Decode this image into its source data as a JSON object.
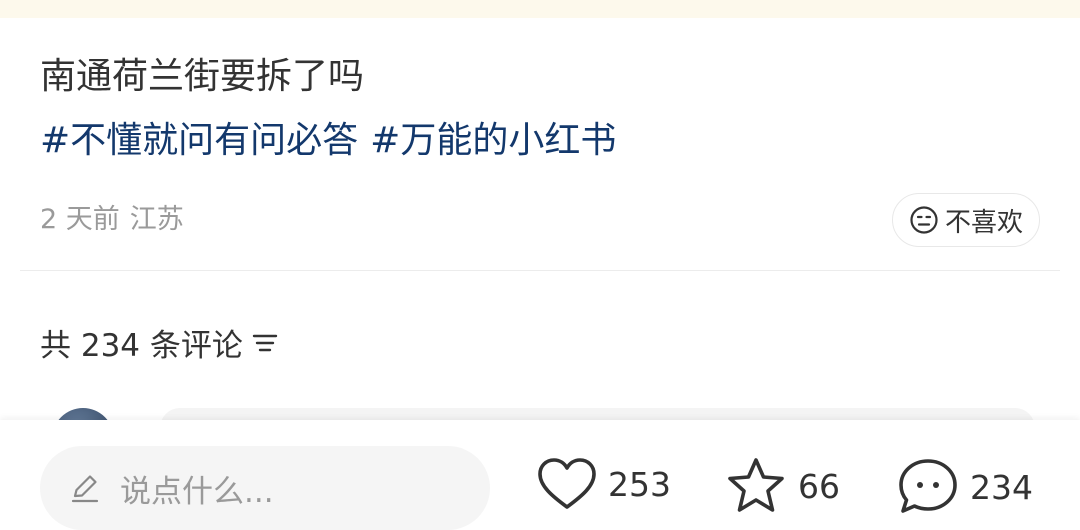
{
  "note": {
    "title": "南通荷兰街要拆了吗",
    "tags": [
      "#不懂就问有问必答",
      "#万能的小红书"
    ],
    "time": "2 天前",
    "location": "江苏",
    "dislike_label": "不喜欢"
  },
  "comments": {
    "header": "共 234 条评论"
  },
  "bottom_bar": {
    "input_placeholder": "说点什么...",
    "likes": "253",
    "collects": "66",
    "comments": "234"
  },
  "colors": {
    "tag": "#13386c",
    "meta": "#9a9a9a",
    "text": "#333333",
    "top_strip": "#fdf9ec"
  },
  "icons": [
    "face-neutral-icon",
    "sort-icon",
    "pencil-icon",
    "heart-icon",
    "star-icon",
    "comment-bubble-icon"
  ]
}
